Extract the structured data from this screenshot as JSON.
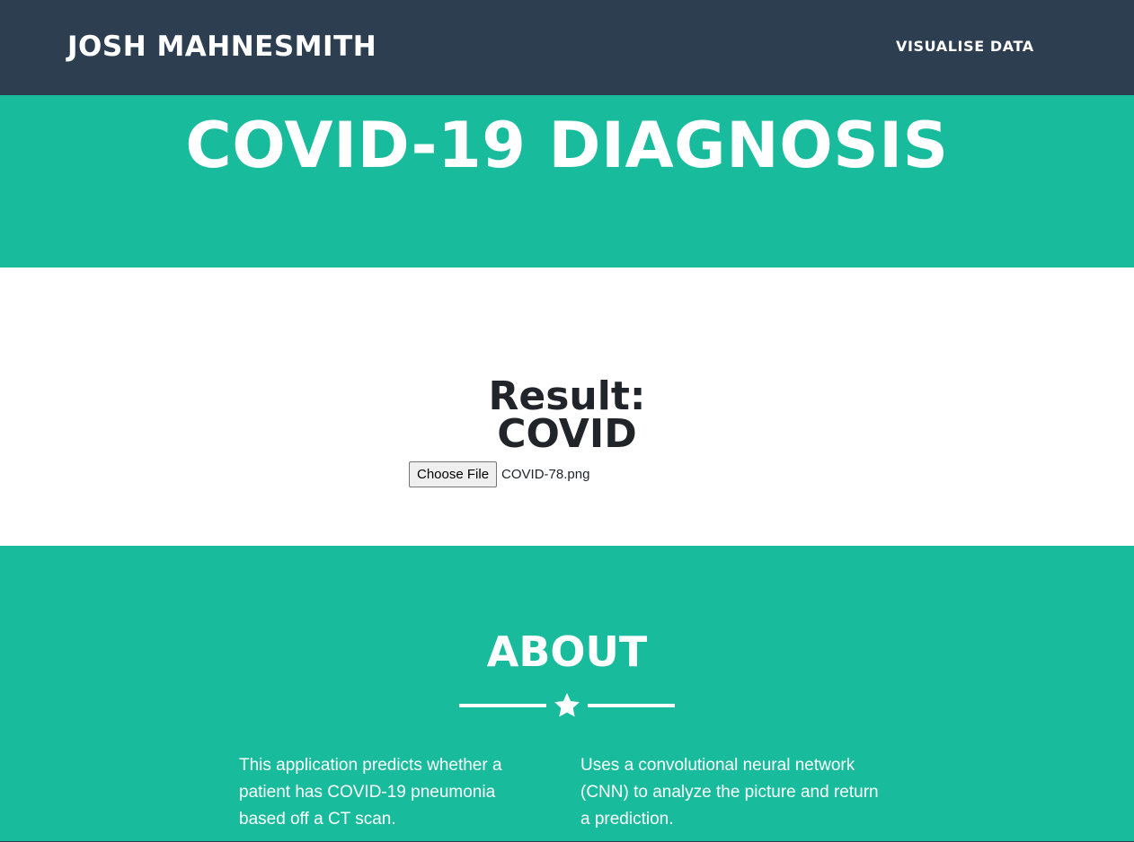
{
  "navbar": {
    "brand": "JOSH MAHNESMITH",
    "link_visualise": "VISUALISE DATA"
  },
  "masthead": {
    "title": "COVID-19 DIAGNOSIS"
  },
  "result": {
    "label": "Result:",
    "value": "COVID",
    "file_button_label": "Choose File",
    "file_name": "COVID-78.png"
  },
  "about": {
    "title": "ABOUT",
    "divider_icon": "star-icon",
    "left_text": "This application predicts whether a patient has COVID-19 pneumonia based off a CT scan.",
    "right_text": "Uses a convolutional neural network (CNN) to analyze the picture and return a prediction."
  },
  "colors": {
    "navbar": "#2c3e50",
    "primary": "#18bc9c",
    "text_dark": "#212529",
    "white": "#ffffff"
  }
}
